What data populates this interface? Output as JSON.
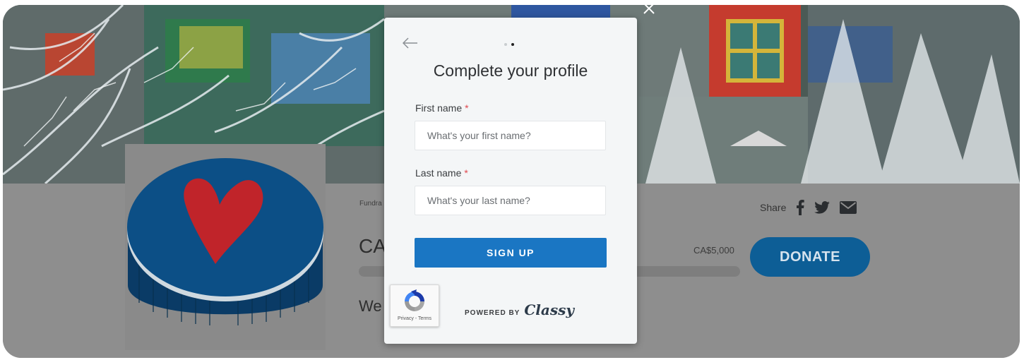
{
  "page": {
    "breadcrumb": "Fundra",
    "title_fragment": "CA",
    "description_fragment": "We",
    "goal": "CA$5,000",
    "donate_label": "DONATE",
    "share_label": "Share"
  },
  "icons": {
    "facebook": "facebook-icon",
    "twitter": "twitter-icon",
    "email": "email-icon",
    "close": "close-icon",
    "back": "back-arrow-icon",
    "recaptcha": "recaptcha-icon"
  },
  "modal": {
    "title": "Complete your profile",
    "step_current": 2,
    "step_total": 2,
    "first_name": {
      "label": "First name",
      "required_mark": "*",
      "placeholder": "What's your first name?",
      "value": ""
    },
    "last_name": {
      "label": "Last name",
      "required_mark": "*",
      "placeholder": "What's your last name?",
      "value": ""
    },
    "submit_label": "SIGN UP",
    "powered_by": "POWERED BY",
    "brand": "Classy"
  },
  "recaptcha": {
    "links": "Privacy - Terms"
  },
  "colors": {
    "donate": "#0d5e96",
    "signup": "#1a76c3",
    "required": "#e0484f",
    "logo_puck": "#0c4f86",
    "logo_heart": "#c0242a"
  }
}
